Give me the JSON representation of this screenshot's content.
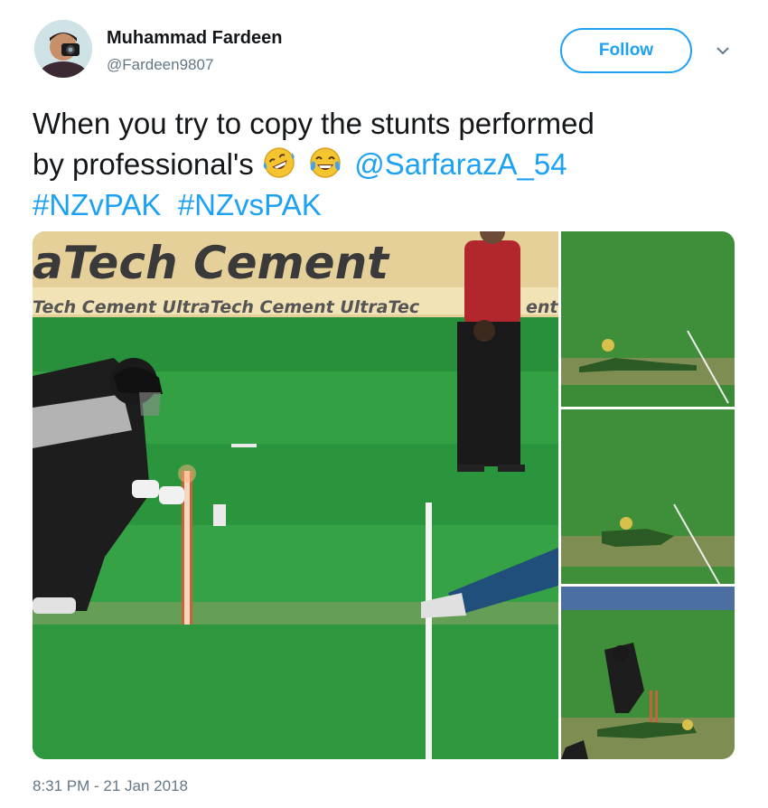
{
  "author": {
    "name": "Muhammad Fardeen",
    "handle": "@Fardeen9807",
    "avatar_icon": "avatar-photographer"
  },
  "follow_label": "Follow",
  "tweet": {
    "text_line1": "When you try to copy the stunts performed",
    "text_line2_prefix": "by professional's",
    "emojis": [
      "rolling-on-floor-laughing-emoji",
      "tears-of-joy-emoji"
    ],
    "mention": "@SarfarazA_54",
    "hashtags": [
      "#NZvPAK",
      "#NZvsPAK"
    ]
  },
  "media": {
    "main_banner_text": "aTech Cement",
    "main_banner_sub": "Tech  Cement  UltraTech  Cement  UltraTec",
    "main_banner_right": "ent"
  },
  "timestamp": "8:31 PM - 21 Jan 2018",
  "colors": {
    "link": "#1da1f2",
    "text": "#14171a",
    "secondary": "#657786",
    "pitch_green": "#2f9b3e"
  }
}
